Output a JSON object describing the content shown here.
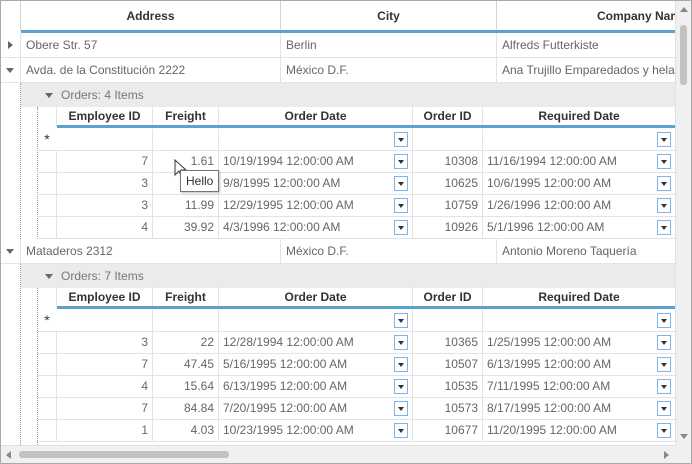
{
  "columns": {
    "address": "Address",
    "city": "City",
    "company": "Company Name"
  },
  "customers": [
    {
      "address": "Obere Str. 57",
      "city": "Berlin",
      "company": "Alfreds Futterkiste"
    },
    {
      "address": "Avda. de la Constitución 2222",
      "city": "México D.F.",
      "company": "Ana Trujillo Emparedados y helados"
    },
    {
      "address": "Mataderos  2312",
      "city": "México D.F.",
      "company": "Antonio Moreno Taquería"
    }
  ],
  "child_columns": {
    "employee_id": "Employee ID",
    "freight": "Freight",
    "order_date": "Order Date",
    "order_id": "Order ID",
    "required_date": "Required Date"
  },
  "groups": [
    {
      "label": "Orders: 4 Items",
      "new_row_icon": "*",
      "rows": [
        {
          "employee_id": "7",
          "freight": "1.61",
          "order_date": "10/19/1994 12:00:00 AM",
          "order_id": "10308",
          "required_date": "11/16/1994 12:00:00 AM"
        },
        {
          "employee_id": "3",
          "freight": "",
          "order_date": "9/8/1995 12:00:00 AM",
          "order_id": "10625",
          "required_date": "10/6/1995 12:00:00 AM"
        },
        {
          "employee_id": "3",
          "freight": "11.99",
          "order_date": "12/29/1995 12:00:00 AM",
          "order_id": "10759",
          "required_date": "1/26/1996 12:00:00 AM"
        },
        {
          "employee_id": "4",
          "freight": "39.92",
          "order_date": "4/3/1996 12:00:00 AM",
          "order_id": "10926",
          "required_date": "5/1/1996 12:00:00 AM"
        }
      ]
    },
    {
      "label": "Orders: 7 Items",
      "new_row_icon": "*",
      "rows": [
        {
          "employee_id": "3",
          "freight": "22",
          "order_date": "12/28/1994 12:00:00 AM",
          "order_id": "10365",
          "required_date": "1/25/1995 12:00:00 AM"
        },
        {
          "employee_id": "7",
          "freight": "47.45",
          "order_date": "5/16/1995 12:00:00 AM",
          "order_id": "10507",
          "required_date": "6/13/1995 12:00:00 AM"
        },
        {
          "employee_id": "4",
          "freight": "15.64",
          "order_date": "6/13/1995 12:00:00 AM",
          "order_id": "10535",
          "required_date": "7/11/1995 12:00:00 AM"
        },
        {
          "employee_id": "7",
          "freight": "84.84",
          "order_date": "7/20/1995 12:00:00 AM",
          "order_id": "10573",
          "required_date": "8/17/1995 12:00:00 AM"
        },
        {
          "employee_id": "1",
          "freight": "4.03",
          "order_date": "10/23/1995 12:00:00 AM",
          "order_id": "10677",
          "required_date": "11/20/1995 12:00:00 AM"
        }
      ]
    }
  ],
  "tooltip": "Hello",
  "icons": {
    "expand": "triangle-right-icon",
    "collapse": "triangle-down-icon",
    "dropdown": "chevron-down-icon"
  },
  "accent_color": "#5ba3cd"
}
